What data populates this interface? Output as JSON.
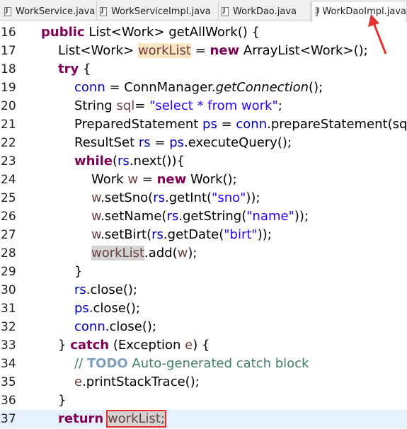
{
  "tabs": [
    {
      "label": "WorkService.java",
      "active": false
    },
    {
      "label": "WorkServiceImpl.java",
      "active": false
    },
    {
      "label": "WorkDao.java",
      "active": false
    },
    {
      "label": "WorkDaoImpl.java",
      "active": true
    }
  ],
  "colors": {
    "keyword": "#7f0055",
    "string": "#2a00ff",
    "field": "#0000c0",
    "local": "#6a3e3e",
    "comment": "#3f7f5f",
    "annotation_red": "#e53030",
    "current_line": "#e8f2fe"
  },
  "lines": [
    {
      "num": "16",
      "tokens": [
        {
          "t": "public",
          "c": "kw"
        },
        {
          "t": " List<Work> getAllWork() {"
        }
      ]
    },
    {
      "num": "17",
      "tokens": [
        {
          "t": "List<Work> "
        },
        {
          "t": "workList",
          "c": "loc occ"
        },
        {
          "t": " = "
        },
        {
          "t": "new",
          "c": "kw"
        },
        {
          "t": " ArrayList<Work>();"
        }
      ]
    },
    {
      "num": "18",
      "tokens": [
        {
          "t": "try",
          "c": "kw"
        },
        {
          "t": " {"
        }
      ]
    },
    {
      "num": "19",
      "tokens": [
        {
          "t": "conn",
          "c": "var"
        },
        {
          "t": " = ConnManager."
        },
        {
          "t": "getConnection",
          "c": "ital"
        },
        {
          "t": "();"
        }
      ]
    },
    {
      "num": "20",
      "tokens": [
        {
          "t": "String "
        },
        {
          "t": "sql",
          "c": "loc"
        },
        {
          "t": "= "
        },
        {
          "t": "\"select * from work\"",
          "c": "str"
        },
        {
          "t": ";"
        }
      ]
    },
    {
      "num": "21",
      "tokens": [
        {
          "t": "PreparedStatement "
        },
        {
          "t": "ps",
          "c": "var"
        },
        {
          "t": " = "
        },
        {
          "t": "conn",
          "c": "var"
        },
        {
          "t": ".prepareStatement(sq"
        }
      ]
    },
    {
      "num": "22",
      "tokens": [
        {
          "t": "ResultSet "
        },
        {
          "t": "rs",
          "c": "var"
        },
        {
          "t": " = "
        },
        {
          "t": "ps",
          "c": "var"
        },
        {
          "t": ".executeQuery();"
        }
      ]
    },
    {
      "num": "23",
      "tokens": [
        {
          "t": "while",
          "c": "kw"
        },
        {
          "t": "("
        },
        {
          "t": "rs",
          "c": "var"
        },
        {
          "t": ".next()){"
        }
      ]
    },
    {
      "num": "24",
      "tokens": [
        {
          "t": "Work "
        },
        {
          "t": "w",
          "c": "loc"
        },
        {
          "t": " = "
        },
        {
          "t": "new",
          "c": "kw"
        },
        {
          "t": " Work();"
        }
      ]
    },
    {
      "num": "25",
      "tokens": [
        {
          "t": "w",
          "c": "loc"
        },
        {
          "t": ".setSno("
        },
        {
          "t": "rs",
          "c": "var"
        },
        {
          "t": ".getInt("
        },
        {
          "t": "\"sno\"",
          "c": "str"
        },
        {
          "t": "));"
        }
      ]
    },
    {
      "num": "26",
      "tokens": [
        {
          "t": "w",
          "c": "loc"
        },
        {
          "t": ".setName("
        },
        {
          "t": "rs",
          "c": "var"
        },
        {
          "t": ".getString("
        },
        {
          "t": "\"name\"",
          "c": "str"
        },
        {
          "t": "));"
        }
      ]
    },
    {
      "num": "27",
      "tokens": [
        {
          "t": "w",
          "c": "loc"
        },
        {
          "t": ".setBirt("
        },
        {
          "t": "rs",
          "c": "var"
        },
        {
          "t": ".getDate("
        },
        {
          "t": "\"birt\"",
          "c": "str"
        },
        {
          "t": "));"
        }
      ]
    },
    {
      "num": "28",
      "tokens": [
        {
          "t": "workList",
          "c": "loc occg"
        },
        {
          "t": ".add("
        },
        {
          "t": "w",
          "c": "loc"
        },
        {
          "t": ");"
        }
      ]
    },
    {
      "num": "29",
      "tokens": [
        {
          "t": "}"
        }
      ]
    },
    {
      "num": "30",
      "tokens": [
        {
          "t": "rs",
          "c": "var"
        },
        {
          "t": ".close();"
        }
      ]
    },
    {
      "num": "31",
      "tokens": [
        {
          "t": "ps",
          "c": "var"
        },
        {
          "t": ".close();"
        }
      ]
    },
    {
      "num": "32",
      "tokens": [
        {
          "t": "conn",
          "c": "var"
        },
        {
          "t": ".close();"
        }
      ]
    },
    {
      "num": "33",
      "tokens": [
        {
          "t": "} "
        },
        {
          "t": "catch",
          "c": "kw"
        },
        {
          "t": " (Exception "
        },
        {
          "t": "e",
          "c": "loc"
        },
        {
          "t": ") {"
        }
      ]
    },
    {
      "num": "34",
      "tokens": [
        {
          "t": "// ",
          "c": "com"
        },
        {
          "t": "TODO",
          "c": "todo"
        },
        {
          "t": " Auto-generated catch block",
          "c": "com"
        }
      ]
    },
    {
      "num": "35",
      "tokens": [
        {
          "t": "e",
          "c": "loc"
        },
        {
          "t": ".printStackTrace();"
        }
      ]
    },
    {
      "num": "36",
      "tokens": [
        {
          "t": "}"
        }
      ]
    },
    {
      "num": "37",
      "tokens": [
        {
          "t": "return",
          "c": "kw"
        },
        {
          "t": " "
        },
        {
          "t": "workList;",
          "c": "loc occg redbox"
        }
      ]
    }
  ]
}
